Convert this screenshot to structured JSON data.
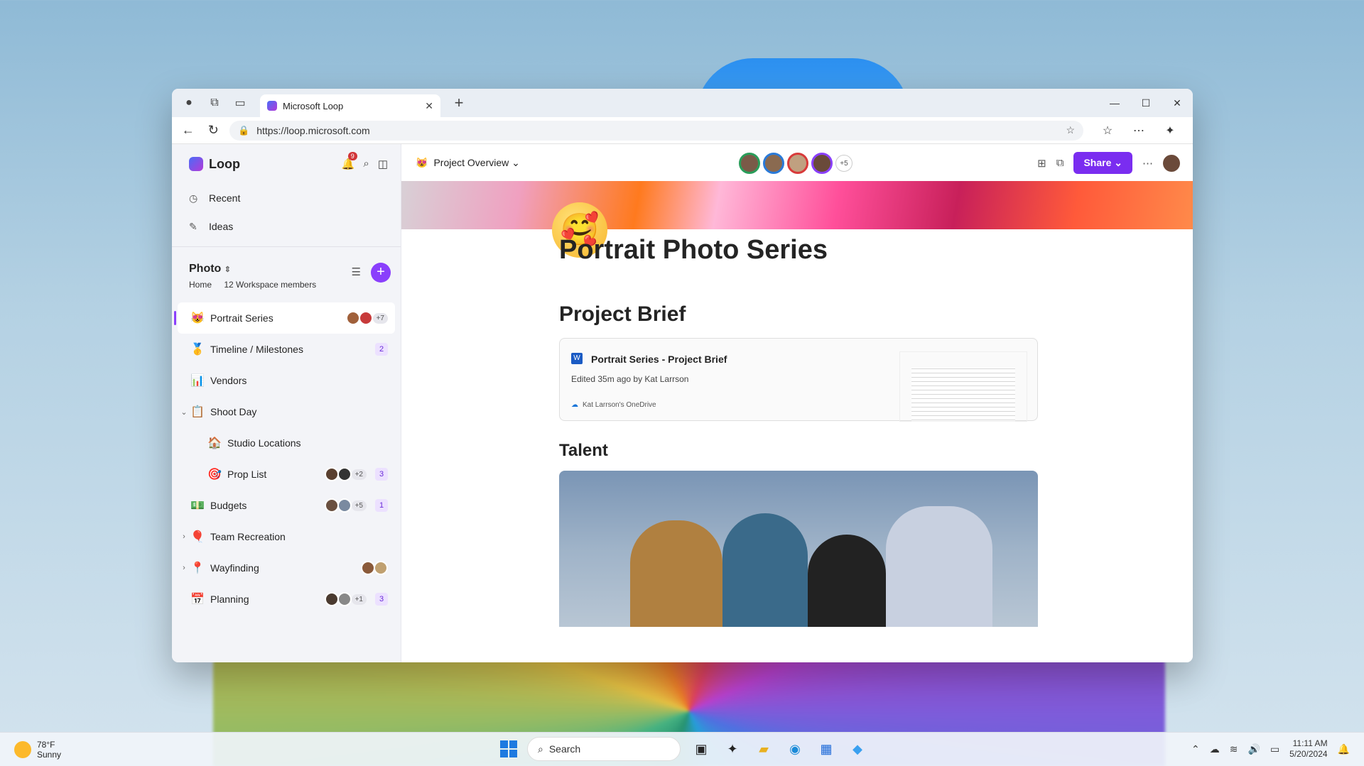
{
  "browser": {
    "tab_title": "Microsoft Loop",
    "url": "https://loop.microsoft.com"
  },
  "sidebar": {
    "brand": "Loop",
    "notification_count": "9",
    "links": [
      {
        "label": "Recent",
        "icon": "clock-icon"
      },
      {
        "label": "Ideas",
        "icon": "pen-icon"
      }
    ],
    "workspace": {
      "name": "Photo",
      "home": "Home",
      "members": "12 Workspace members"
    },
    "pages": [
      {
        "label": "Portrait Series",
        "emoji": "😻",
        "more": "+7",
        "count": ""
      },
      {
        "label": "Timeline / Milestones",
        "emoji": "🥇",
        "more": "",
        "count": "2"
      },
      {
        "label": "Vendors",
        "emoji": "📊",
        "more": "",
        "count": ""
      },
      {
        "label": "Shoot Day",
        "emoji": "📋",
        "more": "",
        "count": ""
      },
      {
        "label": "Studio Locations",
        "emoji": "🏠",
        "more": "",
        "count": ""
      },
      {
        "label": "Prop List",
        "emoji": "🎯",
        "more": "+2",
        "count": "3"
      },
      {
        "label": "Budgets",
        "emoji": "💵",
        "more": "+5",
        "count": "1"
      },
      {
        "label": "Team Recreation",
        "emoji": "🎈",
        "more": "",
        "count": ""
      },
      {
        "label": "Wayfinding",
        "emoji": "📍",
        "more": "",
        "count": ""
      },
      {
        "label": "Planning",
        "emoji": "📅",
        "more": "+1",
        "count": "3"
      }
    ]
  },
  "main": {
    "breadcrumb": "Project Overview",
    "collab_more": "+5",
    "share_label": "Share",
    "title": "Portrait Photo Series",
    "section1": "Project Brief",
    "card": {
      "title": "Portrait Series - Project Brief",
      "edited": "Edited 35m ago by Kat Larrson",
      "location": "Kat Larrson's OneDrive"
    },
    "section2": "Talent"
  },
  "taskbar": {
    "temp": "78°F",
    "condition": "Sunny",
    "search_placeholder": "Search",
    "time": "11:11 AM",
    "date": "5/20/2024"
  }
}
